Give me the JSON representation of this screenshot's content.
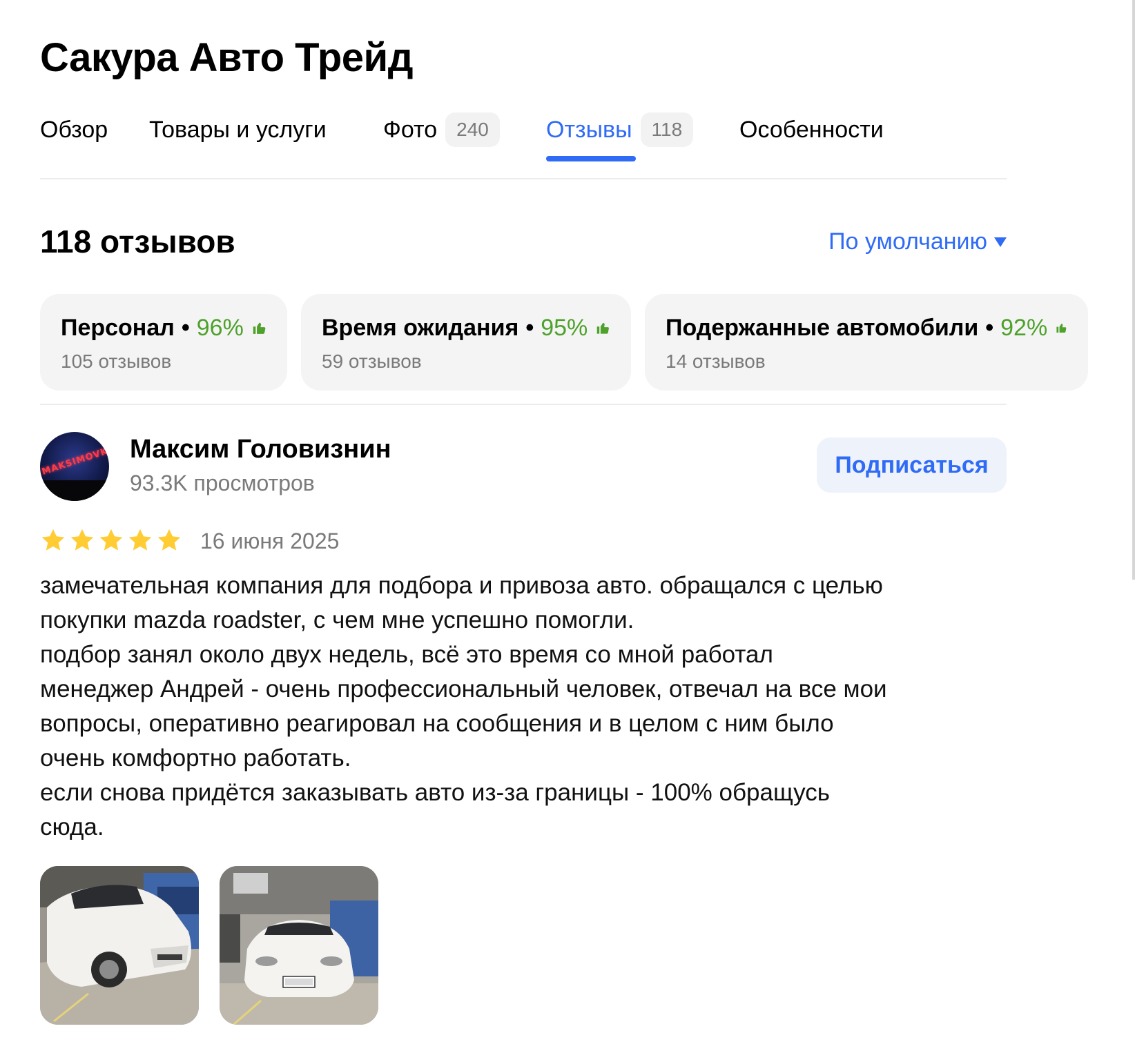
{
  "company": {
    "name": "Сакура Авто Трейд"
  },
  "tabs": [
    {
      "label": "Обзор"
    },
    {
      "label": "Товары и услуги"
    },
    {
      "label": "Фото",
      "count": "240"
    },
    {
      "label": "Отзывы",
      "count": "118",
      "active": true
    },
    {
      "label": "Особенности"
    }
  ],
  "reviews_header": {
    "title": "118 отзывов",
    "sort_label": "По умолчанию"
  },
  "aspects": [
    {
      "name": "Персонал",
      "percent": "96%",
      "count_text": "105 отзывов"
    },
    {
      "name": "Время ожидания",
      "percent": "95%",
      "count_text": "59 отзывов"
    },
    {
      "name": "Подержанные автомобили",
      "percent": "92%",
      "count_text": "14 отзывов"
    }
  ],
  "aspect_separator": "•",
  "review": {
    "author": {
      "name": "Максим Головизнин",
      "views": "93.3K просмотров",
      "avatar_text": "MAKSIMOVKA"
    },
    "subscribe_label": "Подписаться",
    "rating": 5,
    "date": "16 июня 2025",
    "text_lines": [
      "замечательная компания для подбора и привоза авто. обращался с целью",
      "покупки mazda roadster, с чем мне успешно помогли.",
      "подбор занял около двух недель, всё это время со мной работал",
      "менеджер Андрей - очень профессиональный человек, отвечал на все мои",
      "вопросы, оперативно реагировал на сообщения и в целом с ним было",
      "очень комфортно работать.",
      "если снова придётся заказывать авто из-за границы - 100% обращусь",
      "сюда."
    ],
    "photos": [
      {
        "subject": "white mazda roadster side view photo"
      },
      {
        "subject": "white mazda roadster front view photo"
      }
    ]
  },
  "colors": {
    "accent": "#2f6bf5",
    "positive": "#4ea12b",
    "star": "#ffcc33",
    "muted": "#7a7a7a"
  }
}
